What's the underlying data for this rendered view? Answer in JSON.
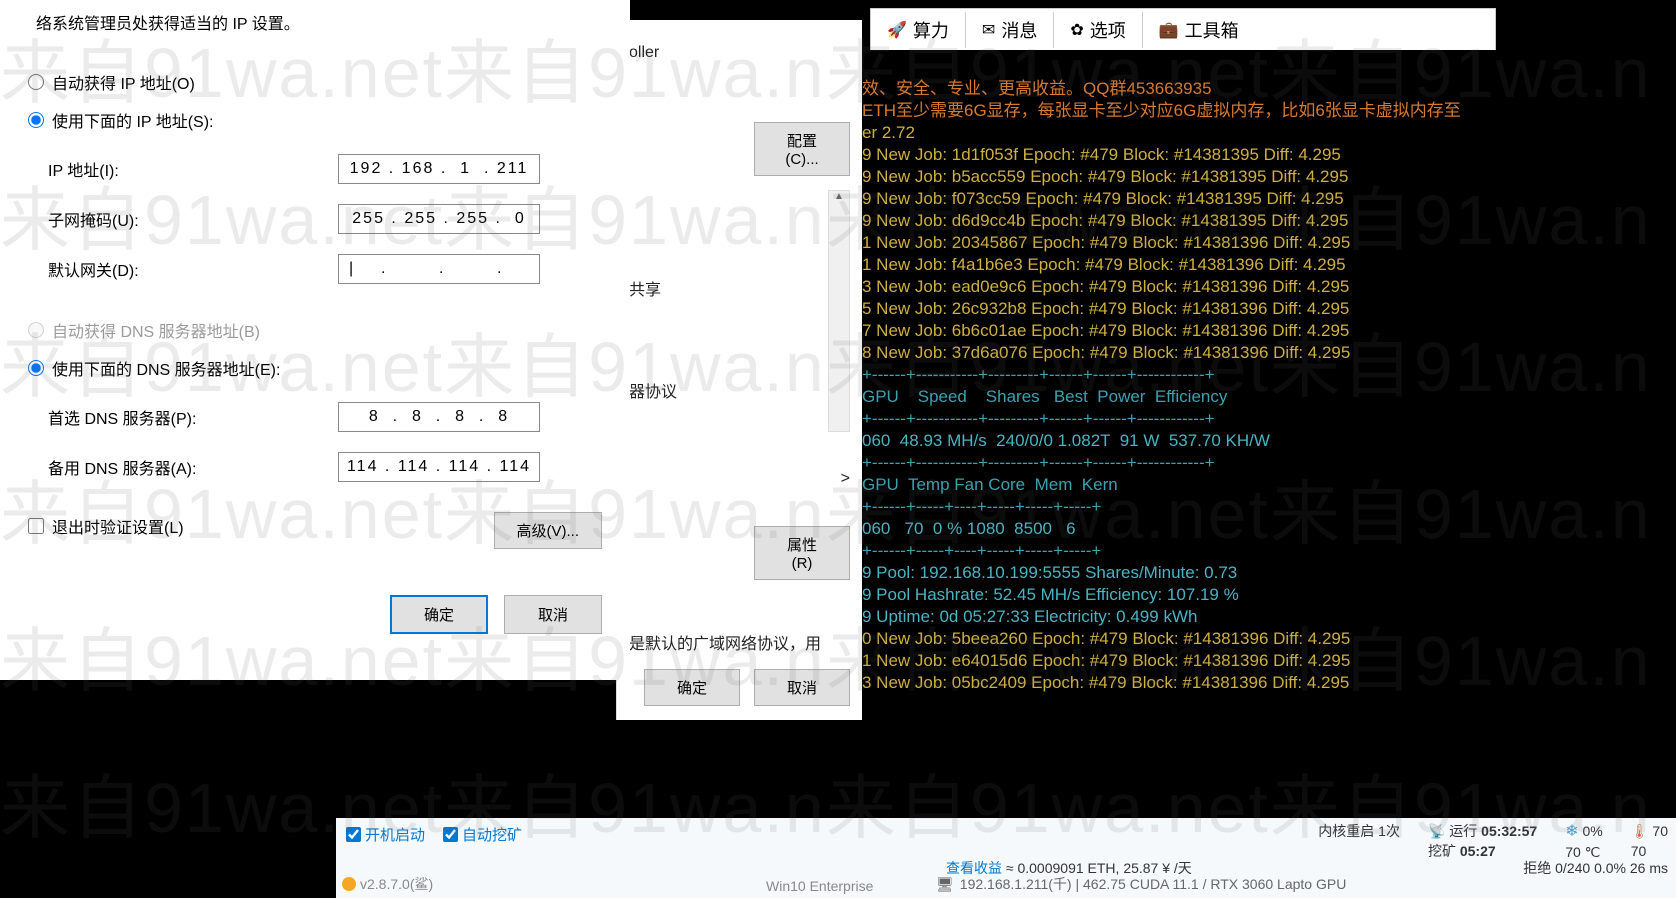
{
  "watermark_text": "来自91wa.net来自91wa.n",
  "ip_dialog": {
    "desc": "络系统管理员处获得适当的 IP 设置。",
    "radio_auto_ip": "自动获得 IP 地址(O)",
    "radio_manual_ip": "使用下面的 IP 地址(S):",
    "label_ip": "IP 地址(I):",
    "value_ip": "192 . 168 .  1  . 211",
    "label_mask": "子网掩码(U):",
    "value_mask": "255 . 255 . 255 .  0",
    "label_gateway": "默认网关(D):",
    "value_gateway": "|    .        .        .",
    "radio_auto_dns": "自动获得 DNS 服务器地址(B)",
    "radio_manual_dns": "使用下面的 DNS 服务器地址(E):",
    "label_dns1": "首选 DNS 服务器(P):",
    "value_dns1": "8  .  8  .  8  .  8",
    "label_dns2": "备用 DNS 服务器(A):",
    "value_dns2": "114 . 114 . 114 . 114",
    "checkbox_validate": "退出时验证设置(L)",
    "btn_advanced": "高级(V)...",
    "btn_ok": "确定",
    "btn_cancel": "取消"
  },
  "net_dialog": {
    "controller": "oller",
    "btn_config": "配置(C)...",
    "item1": "共享",
    "item2": "器协议",
    "btn_prop": "属性(R)",
    "desc": "是默认的广域网络协议，用",
    "btn_ok": "确定",
    "btn_cancel": "取消"
  },
  "tabs": {
    "hashrate": "算力",
    "messages": "消息",
    "options": "选项",
    "toolbox": "工具箱"
  },
  "console": {
    "line1": "效、安全、专业、更高收益。QQ群453663935",
    "line2": "ETH至少需要6G显存，每张显卡至少对应6G虚拟内存，比如6张显卡虚拟内存至",
    "line3": "er 2.72",
    "jobs": [
      "9 New Job: 1d1f053f Epoch: #479 Block: #14381395 Diff: 4.295",
      "9 New Job: b5acc559 Epoch: #479 Block: #14381395 Diff: 4.295",
      "9 New Job: f073cc59 Epoch: #479 Block: #14381395 Diff: 4.295",
      "9 New Job: d6d9cc4b Epoch: #479 Block: #14381395 Diff: 4.295",
      "1 New Job: 20345867 Epoch: #479 Block: #14381396 Diff: 4.295",
      "1 New Job: f4a1b6e3 Epoch: #479 Block: #14381396 Diff: 4.295",
      "3 New Job: ead0e9c6 Epoch: #479 Block: #14381396 Diff: 4.295",
      "5 New Job: 26c932b8 Epoch: #479 Block: #14381396 Diff: 4.295",
      "7 New Job: 6b6c01ae Epoch: #479 Block: #14381396 Diff: 4.295",
      "8 New Job: 37d6a076 Epoch: #479 Block: #14381396 Diff: 4.295"
    ],
    "hdr1": "GPU    Speed    Shares   Best  Power  Efficiency",
    "row1": "060  48.93 MH/s  240/0/0 1.082T  91 W  537.70 KH/W",
    "hdr2": "GPU  Temp Fan Core  Mem  Kern",
    "row2": "060   70  0 % 1080  8500   6",
    "pool1": "9 Pool: 192.168.10.199:5555 Shares/Minute: 0.73",
    "pool2": "9 Pool Hashrate: 52.45 MH/s Efficiency: 107.19 %",
    "uptime": "9 Uptime: 0d 05:27:33 Electricity: 0.499 kWh",
    "jobs2": [
      "0 New Job: 5beea260 Epoch: #479 Block: #14381396 Diff: 4.295",
      "1 New Job: e64015d6 Epoch: #479 Block: #14381396 Diff: 4.295",
      "3 New Job: 05bc2409 Epoch: #479 Block: #14381396 Diff: 4.295"
    ]
  },
  "miner_bar": {
    "chk_startup": "开机启动",
    "chk_automine": "自动挖矿",
    "kernel_restart_label": "内核重启",
    "kernel_restart_count": "1次",
    "runtime_label": "运行",
    "runtime_val": "05:32:57",
    "mining_label": "挖矿",
    "mining_val": "05:27",
    "fan_pct": "0%",
    "temp_c": "70 ℃",
    "temp1": "70",
    "temp2": "70",
    "profit_link": "查看收益",
    "profit_eth": "≈ 0.0009091 ETH,",
    "profit_cny": "25.87 ¥ /天",
    "reject_label": "拒绝",
    "reject_val": "0/240 0.0% 26 ms",
    "version": "v2.8.7.0(鲨)",
    "os": "Win10 Enterprise",
    "gpu_info": "192.168.1.211(千) | 462.75 CUDA 11.1 / RTX 3060 Lapto GPU"
  }
}
